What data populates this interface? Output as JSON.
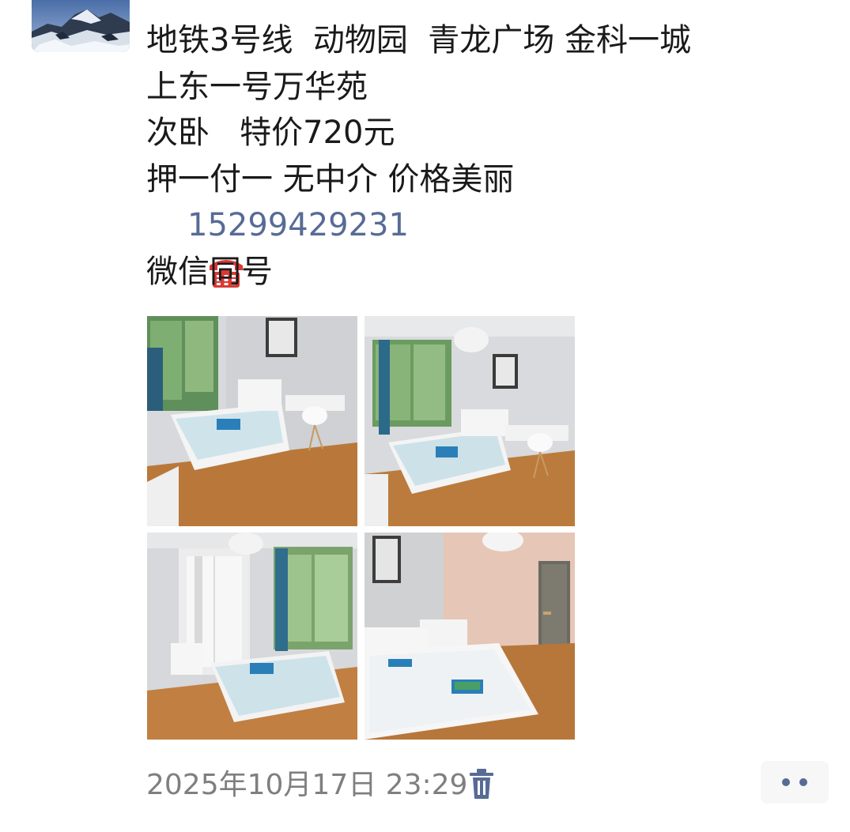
{
  "post": {
    "lines": [
      "地铁3号线  动物园  青龙广场 金科一城",
      "上东一号万华苑",
      "次卧   特价720元",
      "押一付一 无中介 价格美丽"
    ],
    "phone_emoji": "phone-icon",
    "phone_number": "15299429231",
    "wechat_note": "微信同号"
  },
  "photos": [
    {
      "icon": "bedroom-photo-1"
    },
    {
      "icon": "bedroom-photo-2"
    },
    {
      "icon": "bedroom-photo-3"
    },
    {
      "icon": "bedroom-photo-4"
    }
  ],
  "footer": {
    "timestamp": "2025年10月17日 23:29",
    "delete_icon": "trash-icon",
    "more_icon": "more-dots-icon"
  },
  "colors": {
    "link": "#576b95",
    "text": "#1a1a1a",
    "timestamp": "#7f7f7f",
    "more_bg": "#f7f7f7"
  }
}
